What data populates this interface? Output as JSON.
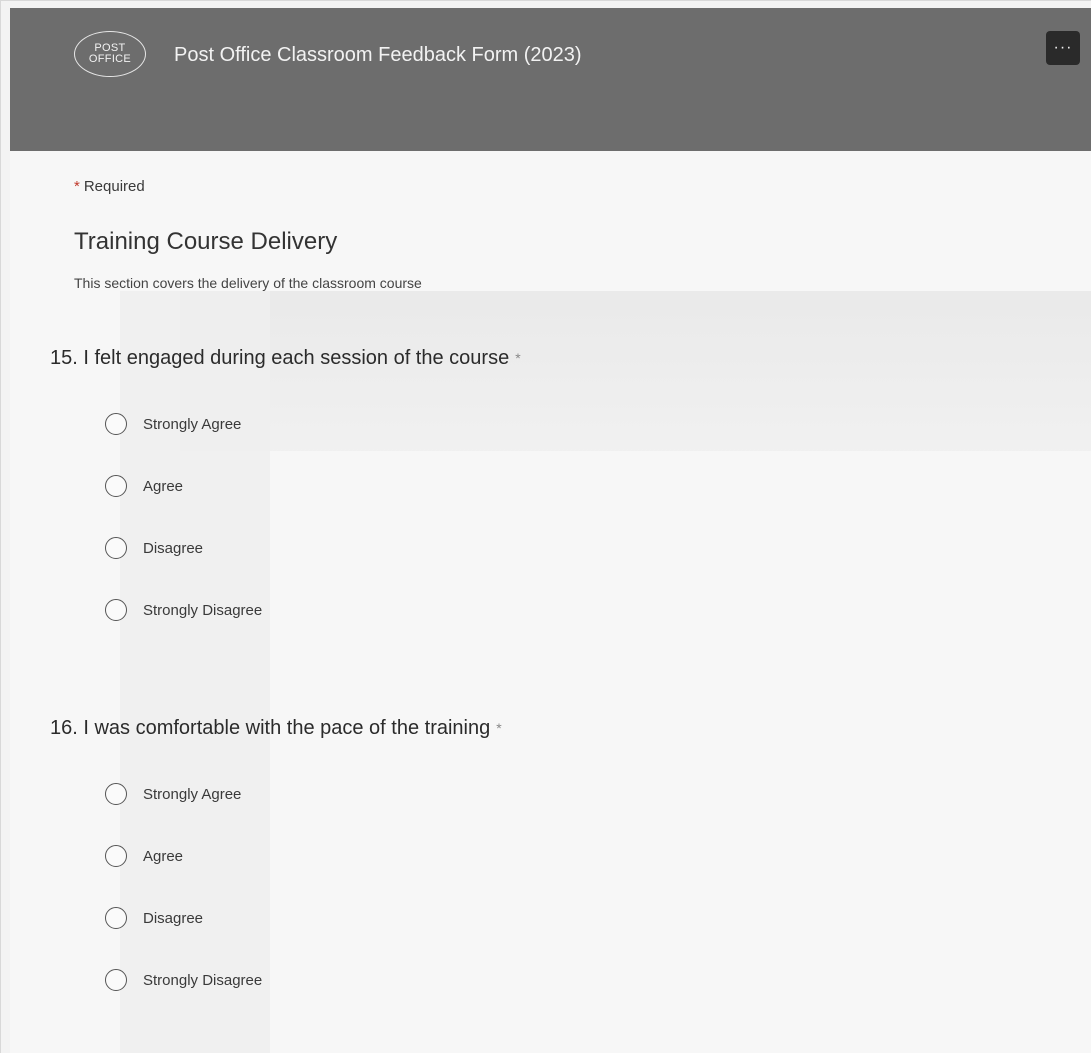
{
  "header": {
    "logo_line1": "POST",
    "logo_line2": "OFFICE",
    "title": "Post Office Classroom Feedback Form (2023)",
    "more_label": "···"
  },
  "form": {
    "required_note": "Required",
    "required_star": "*",
    "section_title": "Training Course Delivery",
    "section_description": "This section covers the delivery of the classroom course",
    "questions": [
      {
        "title": "15. I felt engaged during each session of the course",
        "required_marker": "*",
        "options": [
          "Strongly Agree",
          "Agree",
          "Disagree",
          "Strongly Disagree"
        ]
      },
      {
        "title": "16. I was comfortable with the pace of the training",
        "required_marker": "*",
        "options": [
          "Strongly Agree",
          "Agree",
          "Disagree",
          "Strongly Disagree"
        ]
      }
    ]
  },
  "colors": {
    "header_bg": "#6d6d6d",
    "page_bg": "#f7f7f7",
    "more_button_bg": "#2a2a2a"
  }
}
